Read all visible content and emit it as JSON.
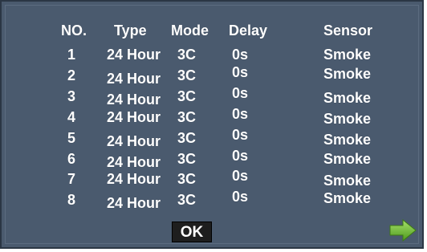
{
  "table": {
    "headers": {
      "no": "NO.",
      "type": "Type",
      "mode": "Mode",
      "delay": "Delay",
      "sensor": "Sensor"
    },
    "rows": [
      {
        "no": "1",
        "type": "24 Hour",
        "mode": "3C",
        "delay": "0s",
        "sensor": "Smoke"
      },
      {
        "no": "2",
        "type": "24 Hour",
        "mode": "3C",
        "delay": "0s",
        "sensor": "Smoke"
      },
      {
        "no": "3",
        "type": "24 Hour",
        "mode": "3C",
        "delay": "0s",
        "sensor": "Smoke"
      },
      {
        "no": "4",
        "type": "24 Hour",
        "mode": "3C",
        "delay": "0s",
        "sensor": "Smoke"
      },
      {
        "no": "5",
        "type": "24 Hour",
        "mode": "3C",
        "delay": "0s",
        "sensor": "Smoke"
      },
      {
        "no": "6",
        "type": "24 Hour",
        "mode": "3C",
        "delay": "0s",
        "sensor": "Smoke"
      },
      {
        "no": "7",
        "type": "24 Hour",
        "mode": "3C",
        "delay": "0s",
        "sensor": "Smoke"
      },
      {
        "no": "8",
        "type": "24 Hour",
        "mode": "3C",
        "delay": "0s",
        "sensor": "Smoke"
      }
    ]
  },
  "buttons": {
    "ok_label": "OK",
    "next_icon": "right-arrow-icon",
    "next_color": "#7cc242"
  },
  "colors": {
    "panel_bg": "#4a5a6e",
    "text": "#ffffff"
  }
}
